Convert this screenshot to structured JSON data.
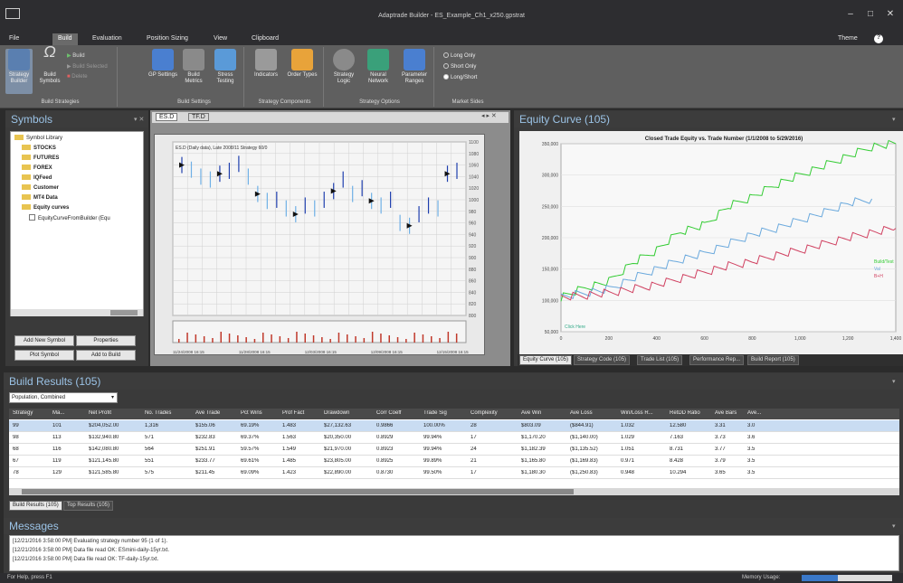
{
  "window": {
    "title": "Adaptrade Builder - ES_Example_Ch1_x250.gpstrat"
  },
  "menu": {
    "tabs": [
      "File",
      "Build",
      "Evaluation",
      "Position Sizing",
      "View",
      "Clipboard"
    ],
    "active": "Build",
    "theme_label": "Theme"
  },
  "ribbon": {
    "build_strategies": {
      "label": "Build Strategies",
      "strategy_builder": "Strategy Builder",
      "build_symbols": "Build Symbols",
      "build": "Build",
      "build_selected": "Build Selected",
      "delete": "Delete"
    },
    "build_settings": {
      "label": "Build Settings",
      "gp_settings": "GP Settings",
      "build_metrics": "Build Metrics",
      "stress_testing": "Stress Testing"
    },
    "strategy_components": {
      "label": "Strategy Components",
      "indicators": "Indicators",
      "order_types": "Order Types"
    },
    "strategy_options": {
      "label": "Strategy Options",
      "strategy_logic": "Strategy Logic",
      "neural_network": "Neural Network",
      "parameter_ranges": "Parameter Ranges"
    },
    "market_sides": {
      "label": "Market Sides",
      "options": [
        "Long Only",
        "Short Only",
        "Long/Short"
      ],
      "selected": "Long/Short"
    }
  },
  "symbols": {
    "title": "Symbols",
    "tree": [
      "Symbol Library",
      "STOCKS",
      "FUTURES",
      "FOREX",
      "IQFeed",
      "Customer",
      "MT4 Data",
      "Equity curves",
      "EquityCurveFromBuilder (Equ"
    ],
    "buttons": {
      "add_new": "Add New Symbol",
      "properties": "Properties",
      "plot": "Plot Symbol",
      "add_to_build": "Add to Build"
    }
  },
  "price_chart": {
    "tabs": [
      "ES.D",
      "TF.D"
    ],
    "legend": "ES.D (Daily data), Late 2008/11 Strategy 60/0",
    "y_ticks": [
      "1100",
      "1080",
      "1060",
      "1040",
      "1020",
      "1000",
      "980",
      "960",
      "940",
      "920",
      "900",
      "880",
      "860",
      "840",
      "820",
      "800"
    ],
    "x_ticks": [
      "11/24/2008 16:15",
      "11/28/2008 16:15",
      "12/03/2008 16:15",
      "12/09/2008 16:15",
      "12/15/2008 16:15"
    ],
    "closes": [
      1060,
      1052,
      1040,
      1035,
      1045,
      1050,
      1062,
      1040,
      1010,
      998,
      1000,
      985,
      975,
      990,
      985,
      1000,
      1015,
      1035,
      1010,
      1020,
      998,
      990,
      1000,
      960,
      955,
      975,
      990,
      985,
      1045,
      1050
    ]
  },
  "equity": {
    "title": "Equity Curve (105)",
    "chart_data": {
      "type": "line",
      "title": "Closed Trade Equity vs. Trade Number (1/1/2008 to 5/29/2016)",
      "x_ticks": [
        "0",
        "200",
        "400",
        "600",
        "800",
        "1,000",
        "1,200",
        "1,400"
      ],
      "y_ticks": [
        "350,000",
        "300,000",
        "250,000",
        "200,000",
        "150,000",
        "100,000",
        "50,000"
      ],
      "xlim": [
        0,
        1400
      ],
      "ylim": [
        50000,
        350000
      ],
      "series": [
        {
          "name": "Build/Test",
          "color": "#33cc33",
          "points": [
            [
              0,
              105000
            ],
            [
              100,
              120000
            ],
            [
              200,
              130000
            ],
            [
              300,
              160000
            ],
            [
              400,
              180000
            ],
            [
              500,
              210000
            ],
            [
              600,
              220000
            ],
            [
              700,
              250000
            ],
            [
              800,
              265000
            ],
            [
              900,
              285000
            ],
            [
              1000,
              300000
            ],
            [
              1100,
              315000
            ],
            [
              1200,
              330000
            ],
            [
              1300,
              345000
            ],
            [
              1400,
              350000
            ]
          ]
        },
        {
          "name": "Val",
          "color": "#6aa9dd",
          "points": [
            [
              0,
              105000
            ],
            [
              100,
              112000
            ],
            [
              200,
              118000
            ],
            [
              300,
              135000
            ],
            [
              400,
              150000
            ],
            [
              500,
              165000
            ],
            [
              600,
              175000
            ],
            [
              700,
              190000
            ],
            [
              800,
              205000
            ],
            [
              900,
              215000
            ],
            [
              1000,
              228000
            ],
            [
              1100,
              240000
            ],
            [
              1200,
              255000
            ],
            [
              1300,
              262000
            ]
          ]
        },
        {
          "name": "B+H",
          "color": "#d04060",
          "points": [
            [
              0,
              105000
            ],
            [
              100,
              108000
            ],
            [
              200,
              112000
            ],
            [
              300,
              118000
            ],
            [
              400,
              125000
            ],
            [
              500,
              135000
            ],
            [
              600,
              145000
            ],
            [
              700,
              155000
            ],
            [
              800,
              162000
            ],
            [
              900,
              172000
            ],
            [
              1000,
              180000
            ],
            [
              1100,
              190000
            ],
            [
              1200,
              200000
            ],
            [
              1300,
              208000
            ],
            [
              1400,
              215000
            ]
          ]
        }
      ],
      "annotation": "Click Here"
    },
    "tabs": [
      "Equity Curve (105)",
      "Strategy Code (105)",
      "Trade List (105)",
      "Performance Rep...",
      "Build Report (105)"
    ]
  },
  "results": {
    "title": "Build Results (105)",
    "population": "Population, Combined",
    "columns": [
      "Strategy",
      "Ma...",
      "Net Profit",
      "No. Trades",
      "Ave Trade",
      "Pct Wins",
      "Prof Fact",
      "Drawdown",
      "Corr Coeff",
      "Trade Sig",
      "Complexity",
      "Ave Win",
      "Ave Loss",
      "Win/Loss R...",
      "RetDD Ratio",
      "Ave Bars",
      "Ave..."
    ],
    "rows": [
      [
        "99",
        "101",
        "$204,052.00",
        "1,316",
        "$155.06",
        "69.19%",
        "1.483",
        "$27,132.63",
        "0.9866",
        "100.00%",
        "28",
        "$803.09",
        "($844.91)",
        "1.032",
        "12.580",
        "3.31",
        "3.0"
      ],
      [
        "98",
        "113",
        "$132,940.80",
        "571",
        "$232.83",
        "69.37%",
        "1.563",
        "$20,350.00",
        "0.8929",
        "99.94%",
        "17",
        "$1,170.20",
        "($1,140.00)",
        "1.029",
        "7.163",
        "3.73",
        "3.6"
      ],
      [
        "68",
        "116",
        "$142,080.80",
        "564",
        "$251.91",
        "59.57%",
        "1.549",
        "$21,970.00",
        "0.8923",
        "99.94%",
        "24",
        "$1,182.39",
        "($1,135.52)",
        "1.051",
        "8.731",
        "3.77",
        "3.5"
      ],
      [
        "67",
        "119",
        "$121,145.80",
        "551",
        "$233.77",
        "69.61%",
        "1.485",
        "$23,805.00",
        "0.8925",
        "99.89%",
        "21",
        "$1,165.80",
        "($1,169.83)",
        "0.971",
        "8.428",
        "3.79",
        "3.5"
      ],
      [
        "78",
        "129",
        "$121,585.80",
        "575",
        "$211.45",
        "69.09%",
        "1.423",
        "$22,890.00",
        "0.8730",
        "99.50%",
        "17",
        "$1,180.30",
        "($1,250.83)",
        "0.948",
        "10.294",
        "3.65",
        "3.5"
      ]
    ],
    "bottom_tabs": [
      "Build Results (105)",
      "Top Results (105)"
    ]
  },
  "messages": {
    "title": "Messages",
    "lines": [
      "[12/21/2016 3:58:00 PM]  Evaluating strategy number 95 (1 of 1).",
      "[12/21/2016 3:58:00 PM]  Data file read OK: ESmini-daily-15yr.txt.",
      "[12/21/2016 3:58:00 PM]  Data file read OK: TF-daily-15yr.txt."
    ]
  },
  "status": {
    "help": "For Help, press F1",
    "memory_label": "Memory Usage:"
  }
}
